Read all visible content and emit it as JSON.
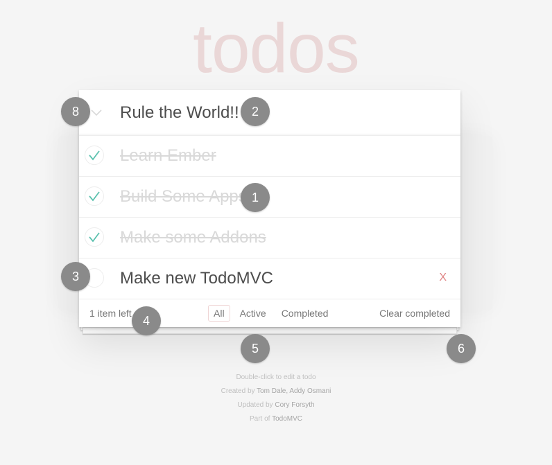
{
  "app_title": "todos",
  "header": {
    "toggle_all_icon": "chevron-down-icon",
    "new_todo_value": "Rule the World!!"
  },
  "todos": [
    {
      "title": "Learn Ember",
      "completed": true
    },
    {
      "title": "Build Some Apps",
      "completed": true
    },
    {
      "title": "Make some Addons",
      "completed": true
    },
    {
      "title": "Make new TodoMVC",
      "completed": false,
      "destroy_label": "X"
    }
  ],
  "footer": {
    "count_text": "1 item left",
    "filters": [
      "All",
      "Active",
      "Completed"
    ],
    "selected_filter": "All",
    "clear_label": "Clear completed"
  },
  "info": {
    "edit_hint": "Double-click to edit a todo",
    "created_prefix": "Created by",
    "created_by": "Tom Dale, Addy Osmani",
    "updated_prefix": "Updated by",
    "updated_by": "Cory Forsyth",
    "part_prefix": "Part of",
    "part_of": "TodoMVC"
  },
  "markers": [
    "8",
    "2",
    "1",
    "3",
    "4",
    "5",
    "6"
  ],
  "colors": {
    "title": "#efd5d5",
    "check": "#5dc2af",
    "destroy": "#e08585",
    "marker": "#8a8a8a"
  }
}
